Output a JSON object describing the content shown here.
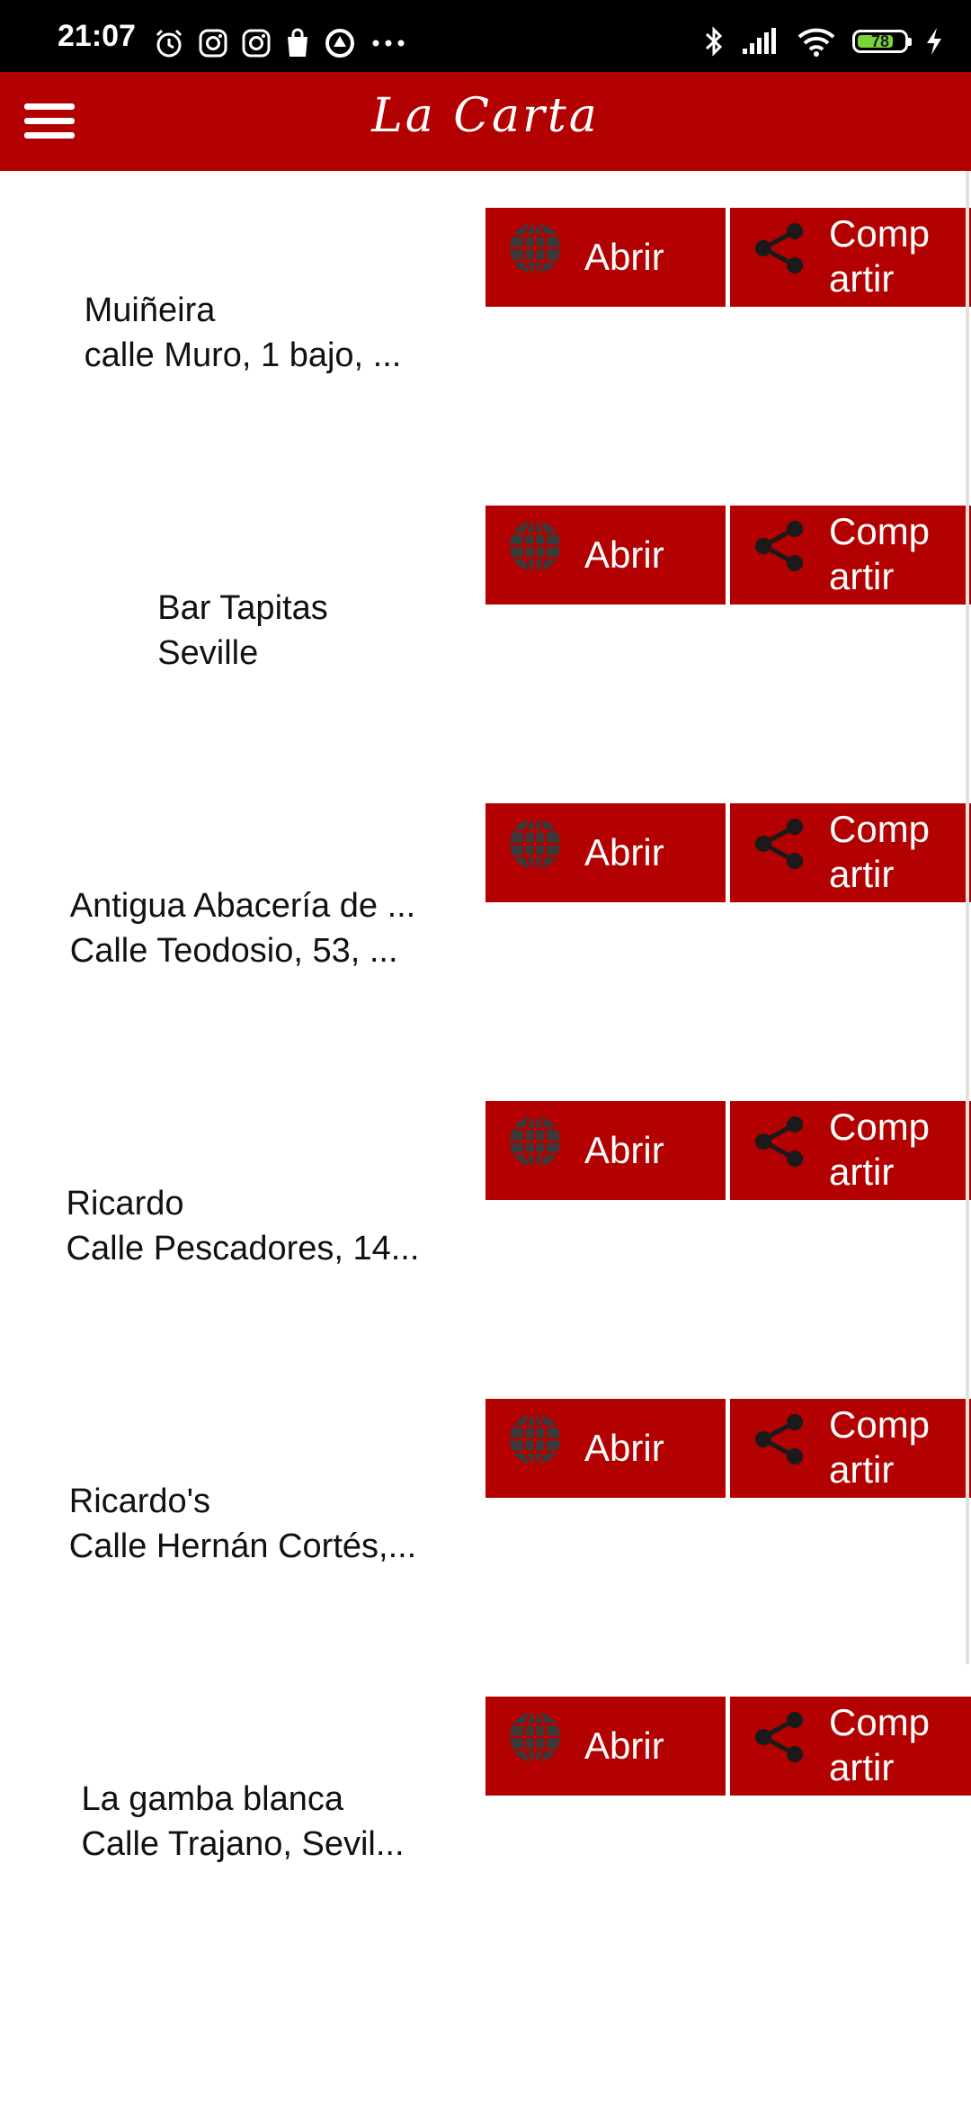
{
  "status_bar": {
    "time": "21:07",
    "battery_percent": "78",
    "battery_level": 0.78,
    "left_icons": [
      "alarm-icon",
      "instagram-icon",
      "instagram-icon",
      "shopping-bag-icon",
      "app-icon",
      "more-dots-icon"
    ],
    "right_icons": [
      "bluetooth-icon",
      "signal-icon",
      "wifi-icon",
      "battery-icon",
      "charging-icon"
    ]
  },
  "app_bar": {
    "title": "La Carta",
    "menu_icon": "menu-icon",
    "color": "#b30000"
  },
  "restaurants": [
    {
      "name": "Muiñeira",
      "address": "calle Muro, 1 bajo, ...",
      "open_label": "Abrir",
      "share_label": "Comp\nartir"
    },
    {
      "name": "Bar Tapitas",
      "address": "Seville",
      "open_label": "Abrir",
      "share_label": "Comp\nartir"
    },
    {
      "name": "Antigua Abacería de ...",
      "address": "Calle Teodosio, 53, ...",
      "open_label": "Abrir",
      "share_label": "Comp\nartir"
    },
    {
      "name": "Ricardo",
      "address": "Calle Pescadores, 14...",
      "open_label": "Abrir",
      "share_label": "Comp\nartir"
    },
    {
      "name": "Ricardo's",
      "address": "Calle Hernán Cortés,...",
      "open_label": "Abrir",
      "share_label": "Comp\nartir"
    },
    {
      "name": "La gamba blanca",
      "address": "Calle Trajano, Sevil...",
      "open_label": "Abrir",
      "share_label": "Comp\nartir"
    }
  ],
  "icons": {
    "open": "globe-icon",
    "share": "share-icon"
  }
}
